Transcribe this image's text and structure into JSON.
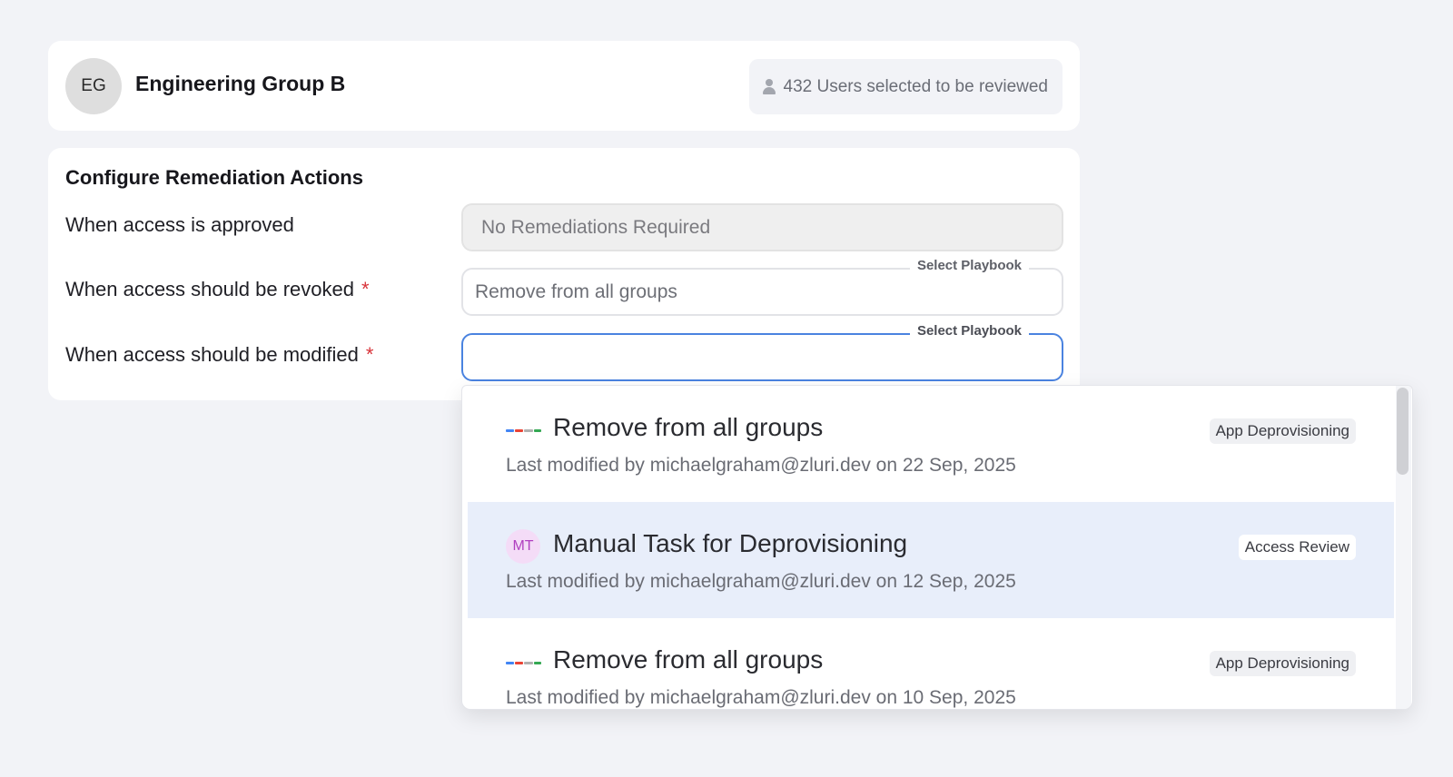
{
  "group": {
    "avatar_initials": "EG",
    "name": "Engineering Group B",
    "users_selected": "432 Users selected to be reviewed",
    "users_icon": "person-icon"
  },
  "remediation": {
    "title": "Configure Remediation Actions",
    "approved": {
      "label": "When access is approved",
      "value": "No Remediations Required"
    },
    "revoked": {
      "label": "When access should be revoked",
      "required_mark": "*",
      "field_label": "Select Playbook",
      "value": "Remove from all groups"
    },
    "modified": {
      "label": "When access should be modified",
      "required_mark": "*",
      "field_label": "Select Playbook",
      "value": ""
    }
  },
  "dropdown": {
    "options": [
      {
        "icon": "google-workspace-logo",
        "title": "Remove from all groups",
        "subtitle": "Last modified by michaelgraham@zluri.dev on 22 Sep, 2025",
        "badge": "App Deprovisioning",
        "highlighted": false
      },
      {
        "icon": "initials-avatar",
        "initials": "MT",
        "title": "Manual Task for Deprovisioning",
        "subtitle": "Last modified by michaelgraham@zluri.dev on 12 Sep, 2025",
        "badge": "Access Review",
        "highlighted": true
      },
      {
        "icon": "google-workspace-logo",
        "title": "Remove from all groups",
        "subtitle": "Last modified by michaelgraham@zluri.dev on 10 Sep, 2025",
        "badge": "App Deprovisioning",
        "highlighted": false
      }
    ]
  },
  "colors": {
    "accent": "#4a83e0",
    "required": "#d8343a",
    "highlight": "#e8eefa",
    "mt_avatar_bg": "#f4dcf7",
    "mt_avatar_fg": "#b03fc0"
  }
}
